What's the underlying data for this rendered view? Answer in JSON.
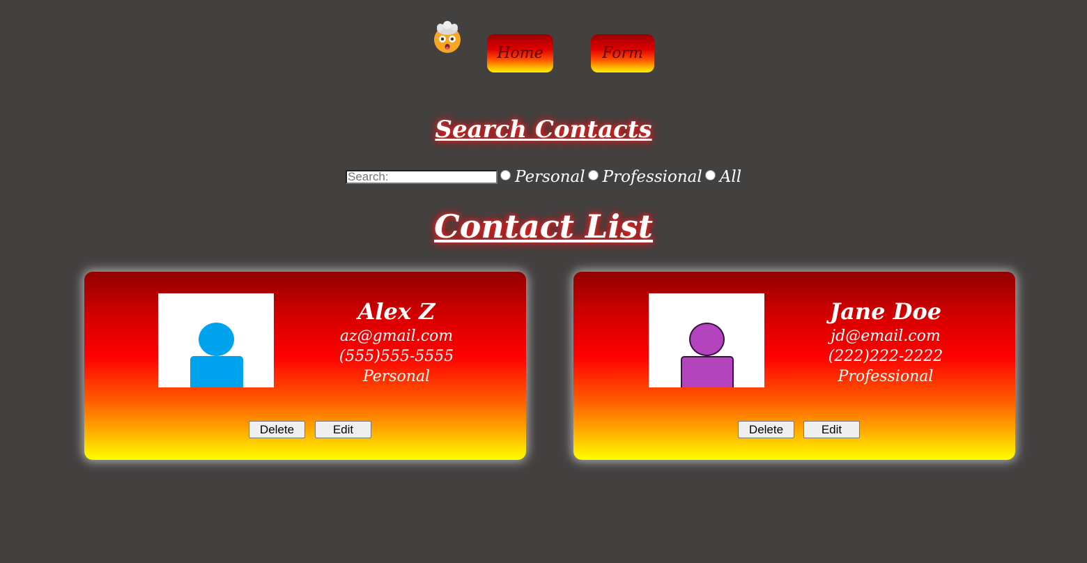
{
  "nav": {
    "logo_icon": "exploding-head-emoji",
    "links": [
      {
        "label": "Home"
      },
      {
        "label": "Form"
      }
    ]
  },
  "search": {
    "heading": "Search Contacts",
    "placeholder": "Search:",
    "value": "",
    "filters": [
      {
        "label": "Personal",
        "checked": false
      },
      {
        "label": "Professional",
        "checked": false
      },
      {
        "label": "All",
        "checked": false
      }
    ]
  },
  "contact_list": {
    "heading": "Contact List",
    "contacts": [
      {
        "name": "Alex Z",
        "email": "az@gmail.com",
        "phone": "(555)555-5555",
        "type": "Personal",
        "avatar_color": "#00a3ee",
        "delete_label": "Delete",
        "edit_label": "Edit"
      },
      {
        "name": "Jane Doe",
        "email": "jd@email.com",
        "phone": "(222)222-2222",
        "type": "Professional",
        "avatar_color": "#b443be",
        "delete_label": "Delete",
        "edit_label": "Edit"
      }
    ]
  },
  "colors": {
    "background": "#434140",
    "card_gradient_top": "#900000",
    "card_gradient_bottom": "#ffff00",
    "heading_glow": "#ff2a2a"
  }
}
